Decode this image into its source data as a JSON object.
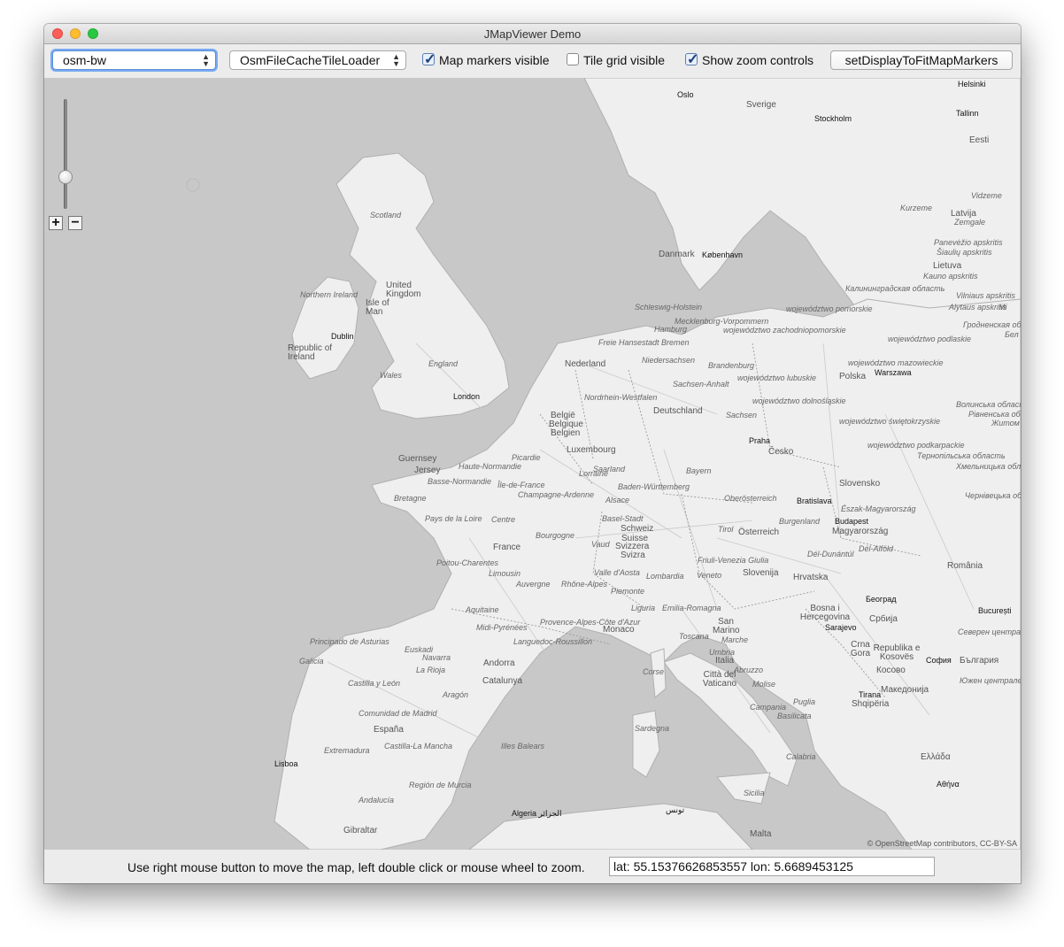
{
  "window": {
    "title": "JMapViewer Demo"
  },
  "toolbar": {
    "tile_source": "osm-bw",
    "tile_loader": "OsmFileCacheTileLoader",
    "markers_visible": {
      "label": "Map markers visible",
      "checked": true
    },
    "tile_grid_visible": {
      "label": "Tile grid visible",
      "checked": false
    },
    "show_zoom_controls": {
      "label": "Show zoom controls",
      "checked": true
    },
    "fit_button": "setDisplayToFitMapMarkers"
  },
  "map": {
    "attribution": "© OpenStreetMap contributors, CC-BY-SA",
    "zoom_in_label": "+",
    "zoom_out_label": "−",
    "zoom_fraction": 0.25,
    "labels": {
      "oslo": "Oslo",
      "sverige": "Sverige",
      "stockholm": "Stockholm",
      "helsinki": "Helsinki",
      "tallinn": "Tallinn",
      "eesti": "Eesti",
      "vidzeme": "Vidzeme",
      "kurzeme": "Kurzeme",
      "latvija": "Latvija",
      "zemgale": "Zemgale",
      "panevezio": "Panevėžio apskritis",
      "siauliu": "Šiaulių apskritis",
      "lietuva": "Lietuva",
      "kauno": "Kauno apskritis",
      "kaliningrad": "Калининградская область",
      "vilniaus": "Vilniaus apskritis",
      "alytaus": "Alytaus apskritis",
      "grodno": "Гродненская область",
      "scotland": "Scotland",
      "danmark": "Danmark",
      "kobenhavn": "København",
      "northern_ireland": "Northern Ireland",
      "united_kingdom": "United Kingdom",
      "isle_of_man": "Isle of Man",
      "dublin": "Dublin",
      "republic_ireland": "Republic of Ireland",
      "england": "England",
      "wales": "Wales",
      "london": "London",
      "schleswig": "Schleswig-Holstein",
      "mecklenburg": "Mecklenburg-Vorpommern",
      "hamburg": "Hamburg",
      "pomorskie": "województwo pomorskie",
      "zachodniopomorskie": "województwo zachodniopomorskie",
      "podlaskie": "województwo podlaskie",
      "bremen": "Freie Hansestadt Bremen",
      "nederland": "Nederland",
      "niedersachsen": "Niedersachsen",
      "brandenburg": "Brandenburg",
      "mazowieckie": "województwo mazowieckie",
      "warszawa": "Warszawa",
      "lubuskie": "województwo lubuskie",
      "polska": "Polska",
      "sachsen_anhalt": "Sachsen-Anhalt",
      "nrw": "Nordrhein-Westfalen",
      "deutschland": "Deutschland",
      "dolnoslaskie": "województwo dolnośląskie",
      "sachsen": "Sachsen",
      "volyn": "Волинська область",
      "belgie": "België",
      "belgique": "Belgique",
      "belgien": "Belgien",
      "swietokrzyskie": "województwo świętokrzyskie",
      "praha": "Praha",
      "cesko": "Česko",
      "luxembourg": "Luxembourg",
      "guernsey": "Guernsey",
      "haute_normandie": "Haute-Normandie",
      "picardie": "Picardie",
      "jersey": "Jersey",
      "podkarpackie": "województwo podkarpackie",
      "ternopil": "Тернопільська область",
      "lorraine": "Lorraine",
      "saarland": "Saarland",
      "basse_normandie": "Basse-Normandie",
      "ile_de_france": "Île-de-France",
      "bayern": "Bayern",
      "champagne": "Champagne-Ardenne",
      "bw": "Baden-Württemberg",
      "slovensko": "Slovensko",
      "khmelnytskyi": "Хмельницька область",
      "bretagne": "Bretagne",
      "alsace": "Alsace",
      "oberosterreich": "Oberösterreich",
      "bratislava": "Bratislava",
      "chernivtsi": "Чернівецька область",
      "pays_loire": "Pays de la Loire",
      "centre": "Centre",
      "basel": "Basel-Stadt",
      "tirol": "Tirol",
      "eszak": "Észak-Magyarország",
      "burgenland": "Burgenland",
      "budapest": "Budapest",
      "schweiz": "Schweiz",
      "osterreich": "Österreich",
      "bourgogne": "Bourgogne",
      "suisse": "Suisse",
      "magyarorszag": "Magyarország",
      "france": "France",
      "svizzera": "Svizzera",
      "vaud": "Vaud",
      "svizra": "Svizra",
      "poitou": "Poitou-Charentes",
      "friuli": "Friuli-Venezia Giulia",
      "del_dunantul": "Dél-Dunántúl",
      "del_alfold": "Dél-Alföld",
      "limousin": "Limousin",
      "valle_aosta": "Valle d'Aosta",
      "lombardia": "Lombardia",
      "veneto": "Veneto",
      "slovenija": "Slovenija",
      "hrvatska": "Hrvatska",
      "romania": "România",
      "auvergne": "Auvergne",
      "rhone_alpes": "Rhône-Alpes",
      "piemonte": "Piemonte",
      "beograd": "Београд",
      "aquitaine": "Aquitaine",
      "liguria": "Liguria",
      "emilia": "Emilia-Romagna",
      "bosna": "Bosna i Hercegovina",
      "bucuresti": "București",
      "sarajevo": "Sarajevo",
      "srbija": "Србија",
      "pyrenees": "Midi-Pyrénées",
      "paca": "Provence-Alpes-Côte d'Azur",
      "monaco": "Monaco",
      "san_marino": "San Marino",
      "severen": "Северен централен",
      "asturias": "Principado de Asturias",
      "languedoc": "Languedoc-Roussillon",
      "toscana": "Toscana",
      "marche": "Marche",
      "euskadi": "Euskadi",
      "navarra": "Navarra",
      "umbria": "Umbria",
      "crna_gora": "Crna Gora",
      "republika_kosova": "Republika e Kosovës",
      "sofia": "София",
      "bulgaria": "България",
      "galicia": "Galicia",
      "andorra": "Andorra",
      "italia": "Italia",
      "abruzzo": "Abruzzo",
      "kosovo": "Косово",
      "la_rioja": "La Rioja",
      "citta_vaticano": "Città del Vaticano",
      "yuzhen": "Южен централен",
      "castilla_leon": "Castilla y León",
      "catalunya": "Catalunya",
      "corse": "Corse",
      "molise": "Molise",
      "makedonija": "Македонија",
      "aragon": "Aragón",
      "tirana": "Tirana",
      "shqiperia": "Shqipëria",
      "madrid": "Comunidad de Madrid",
      "campania": "Campania",
      "puglia": "Puglia",
      "espana": "España",
      "basilicata": "Basilicata",
      "sardegna": "Sardegna",
      "extremadura": "Extremadura",
      "castilla_mancha": "Castilla-La Mancha",
      "illes_balears": "Illes Balears",
      "calabria": "Calabria",
      "ellada": "Ελλάδα",
      "lisboa": "Lisboa",
      "murcia": "Región de Murcia",
      "athina": "Αθήνα",
      "sicilia": "Sicilia",
      "andalucia": "Andalucía",
      "alger": "Algeria الجزائر",
      "tunis": "تونس",
      "gibraltar": "Gibraltar",
      "malta": "Malta",
      "minsk_fragment": "Мі",
      "bel_fragment": "Бел",
      "rivne": "Рівненська об",
      "zhytomyr": "Житом"
    }
  },
  "status": {
    "help": "Use right mouse button to move the map,  left double click or mouse wheel to zoom.",
    "coords": "lat: 55.15376626853557   lon: 5.6689453125"
  }
}
